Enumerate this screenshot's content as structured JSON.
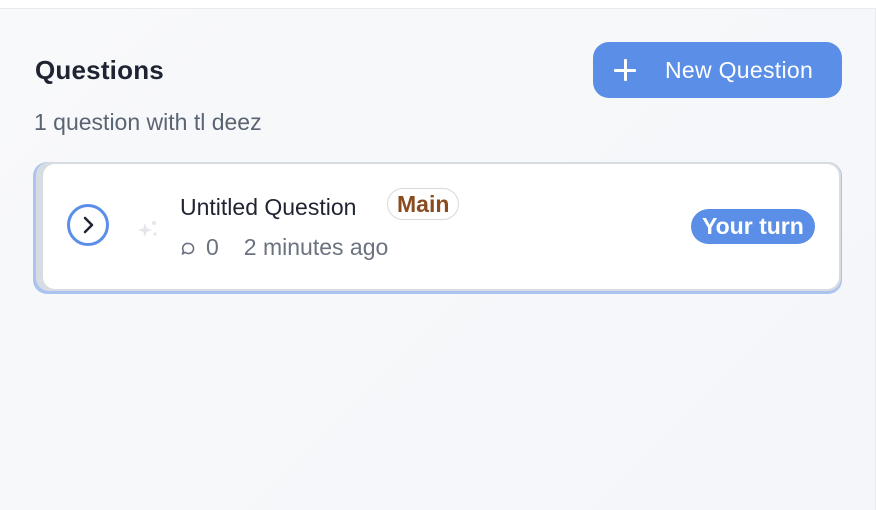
{
  "header": {
    "title": "Questions",
    "subtitle": "1 question with tl deez",
    "new_button_label": "New Question"
  },
  "questions": [
    {
      "title": "Untitled Question",
      "tag": "Main",
      "comment_count": "0",
      "time_ago": "2 minutes ago",
      "status": "Your turn"
    }
  ],
  "icons": {
    "new": "plus-icon",
    "expand": "chevron-right-icon",
    "sparkle": "sparkle-icon",
    "comments": "comment-bubble-icon"
  },
  "colors": {
    "accent": "#5b8ee6",
    "tag_text": "#8a4b1e",
    "title_text": "#1f2433",
    "muted_text": "#5b6472"
  }
}
